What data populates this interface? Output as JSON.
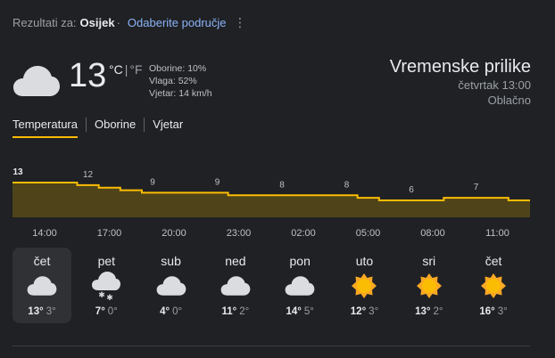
{
  "header": {
    "prefix": "Rezultati za:",
    "city": "Osijek",
    "sep": "·",
    "change_area": "Odaberite područje"
  },
  "current": {
    "icon": "cloud-icon",
    "temp": "13",
    "unit_c": "°C",
    "unit_sep": "|",
    "unit_f": "°F",
    "precip": "Oborine: 10%",
    "humidity": "Vlaga: 52%",
    "wind": "Vjetar: 14 km/h"
  },
  "summary": {
    "title": "Vremenske prilike",
    "datetime": "četvrtak 13:00",
    "condition": "Oblačno"
  },
  "tabs": [
    {
      "label": "Temperatura",
      "active": true
    },
    {
      "label": "Oborine",
      "active": false
    },
    {
      "label": "Vjetar",
      "active": false
    }
  ],
  "chart_data": {
    "type": "area",
    "x": [
      "14:00",
      "15:00",
      "16:00",
      "17:00",
      "18:00",
      "19:00",
      "20:00",
      "21:00",
      "22:00",
      "23:00",
      "00:00",
      "01:00",
      "02:00",
      "03:00",
      "04:00",
      "05:00",
      "06:00",
      "07:00",
      "08:00",
      "09:00",
      "10:00",
      "11:00",
      "12:00",
      "13:00"
    ],
    "values": [
      13,
      13,
      13,
      12,
      11,
      10,
      9,
      9,
      9,
      9,
      8,
      8,
      8,
      8,
      8,
      8,
      7,
      6,
      6,
      6,
      7,
      7,
      7,
      6
    ],
    "labeled_indices": [
      0,
      3,
      6,
      9,
      12,
      15,
      18,
      21
    ],
    "tick_labels": [
      "14:00",
      "17:00",
      "20:00",
      "23:00",
      "02:00",
      "05:00",
      "08:00",
      "11:00"
    ],
    "colors": {
      "line": "#fbbc04",
      "fill": "#4f4419"
    }
  },
  "days": [
    {
      "name": "čet",
      "icon": "cloud-icon",
      "hi": "13°",
      "lo": "3°",
      "selected": true
    },
    {
      "name": "pet",
      "icon": "cloud-snow-icon",
      "hi": "7°",
      "lo": "0°",
      "selected": false
    },
    {
      "name": "sub",
      "icon": "cloud-icon",
      "hi": "4°",
      "lo": "0°",
      "selected": false
    },
    {
      "name": "ned",
      "icon": "cloud-icon",
      "hi": "11°",
      "lo": "2°",
      "selected": false
    },
    {
      "name": "pon",
      "icon": "cloud-icon",
      "hi": "14°",
      "lo": "5°",
      "selected": false
    },
    {
      "name": "uto",
      "icon": "sun-icon",
      "hi": "12°",
      "lo": "3°",
      "selected": false
    },
    {
      "name": "sri",
      "icon": "sun-icon",
      "hi": "13°",
      "lo": "2°",
      "selected": false
    },
    {
      "name": "čet",
      "icon": "sun-icon",
      "hi": "16°",
      "lo": "3°",
      "selected": false
    }
  ]
}
